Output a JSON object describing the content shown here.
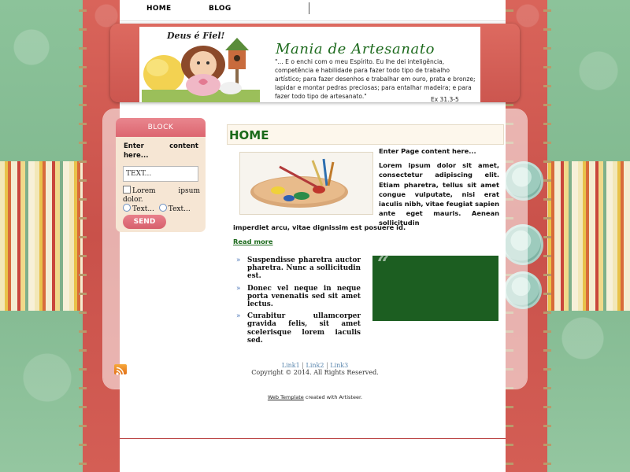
{
  "nav": {
    "items": [
      {
        "label": "HOME"
      },
      {
        "label": "BLOG"
      }
    ]
  },
  "header": {
    "motto": "Deus é Fiel!",
    "title": "Mania de Artesanato",
    "verse": "\"... E o enchi com o meu Espírito. Eu lhe dei inteligência, competência e habilidade para fazer todo tipo de trabalho artístico; para fazer desenhos e trabalhar em ouro, prata e bronze; lapidar e montar pedras preciosas; para entalhar madeira; e para fazer todo tipo de artesanato.\"",
    "verse_ref": "Ex 31.3-5"
  },
  "sidebar": {
    "block_title": "BLOCK",
    "block_text": "Enter content here...",
    "input_value": "TEXT...",
    "checkbox_label": "Lorem ipsum dolor.",
    "radio1_label": "Text...",
    "radio2_label": "Text...",
    "send_label": "SEND"
  },
  "article": {
    "title": "HOME",
    "intro": "Enter Page content here...",
    "body": "Lorem ipsum dolor sit amet, consectetur adipiscing elit. Etiam pharetra, tellus sit amet congue vulputate, nisi erat iaculis nibh, vitae feugiat sapien ante eget mauris. Aenean sollicitudin",
    "body_cont": "imperdiet arcu, vitae dignissim est posuere id.",
    "read_more": "Read more",
    "bullets": [
      "Suspendisse pharetra auctor pharetra. Nunc a sollicitudin est.",
      "Donec vel neque in neque porta venenatis sed sit amet lectus.",
      "Curabitur ullamcorper gravida felis, sit amet scelerisque lorem iaculis sed."
    ],
    "quote_mark": "“"
  },
  "footer": {
    "links": [
      "Link1",
      "Link2",
      "Link3"
    ],
    "separator": "|",
    "copyright": "Copyright © 2014. All Rights Reserved.",
    "credit_link": "Web Template",
    "credit_text": "created with Artisteer."
  },
  "colors": {
    "accent_green": "#1d6a1d",
    "accent_red": "#cc564f",
    "accent_pink": "#dc6670",
    "quote_green": "#1c5e21"
  },
  "icons": [
    "rss-icon",
    "paint-palette-image",
    "doll-illustration"
  ]
}
